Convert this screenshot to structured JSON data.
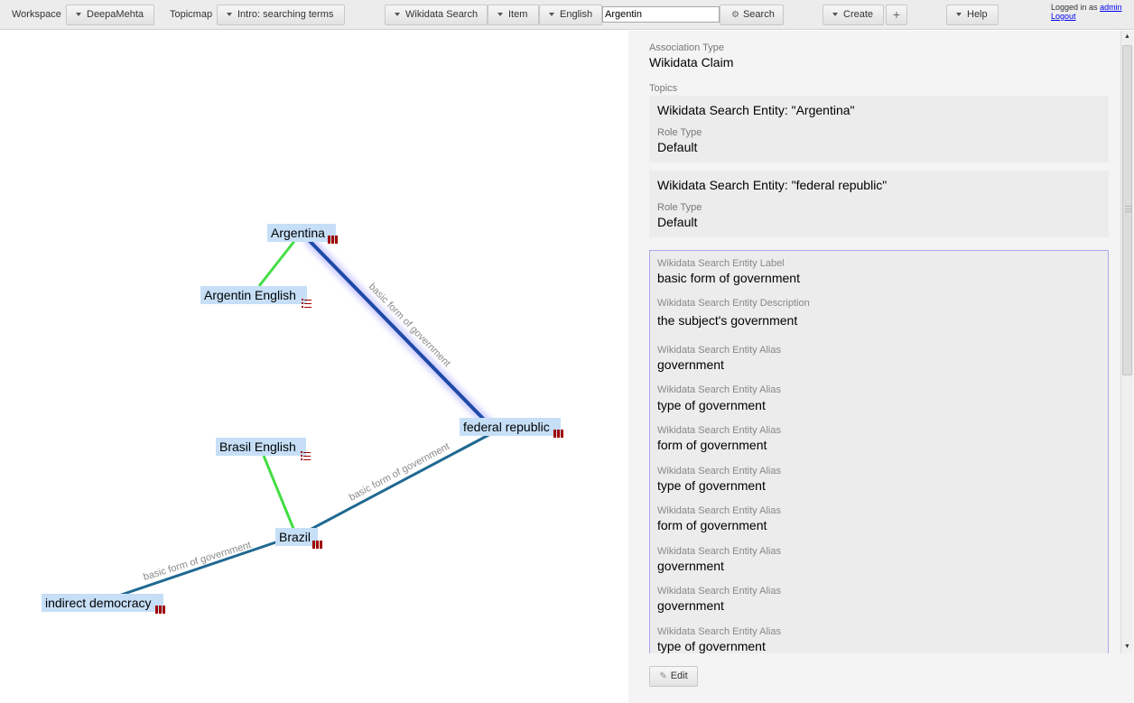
{
  "toolbar": {
    "workspace_label": "Workspace",
    "workspace_value": "DeepaMehta",
    "topicmap_label": "Topicmap",
    "topicmap_value": "Intro: searching terms",
    "search_type": "Wikidata Search",
    "search_scope": "Item",
    "search_language": "English",
    "search_text": "Argentin",
    "search_button": "Search",
    "create_button": "Create",
    "add_button": "+",
    "help_button": "Help",
    "logged_in_text": "Logged in as",
    "username": "admin",
    "logout": "Logout"
  },
  "topicmap": {
    "nodes": [
      {
        "label": "Argentina",
        "icon": "entity-icon"
      },
      {
        "label": "Argentin English",
        "icon": "list-icon"
      },
      {
        "label": "federal republic",
        "icon": "entity-icon"
      },
      {
        "label": "Brasil English",
        "icon": "list-icon"
      },
      {
        "label": "Brazil",
        "icon": "entity-icon"
      },
      {
        "label": "indirect democracy",
        "icon": "entity-icon"
      }
    ],
    "edge_labels": [
      "basic form of government",
      "basic form of government",
      "basic form of government"
    ],
    "colors": {
      "selected_edge": "#1f4aa6",
      "claim_edge": "#1f6891",
      "language_edge": "#44dd44",
      "node_fill": "#c6dff7",
      "icon": "#a00000"
    }
  },
  "detail": {
    "assoc_type_label": "Association Type",
    "assoc_type_value": "Wikidata Claim",
    "topics_label": "Topics",
    "topics": [
      {
        "title": "Wikidata Search Entity: \"Argentina\"",
        "role_label": "Role Type",
        "role_value": "Default"
      },
      {
        "title": "Wikidata Search Entity: \"federal republic\"",
        "role_label": "Role Type",
        "role_value": "Default"
      }
    ],
    "entity": {
      "label_label": "Wikidata Search Entity Label",
      "label_value": "basic form of government",
      "description_label": "Wikidata Search Entity Description",
      "description_value": "the subject's government",
      "alias_label": "Wikidata Search Entity Alias",
      "aliases": [
        "government",
        "type of government",
        "form of government",
        "type of government",
        "form of government",
        "government",
        "government",
        "type of government"
      ]
    },
    "edit_button": "Edit"
  }
}
